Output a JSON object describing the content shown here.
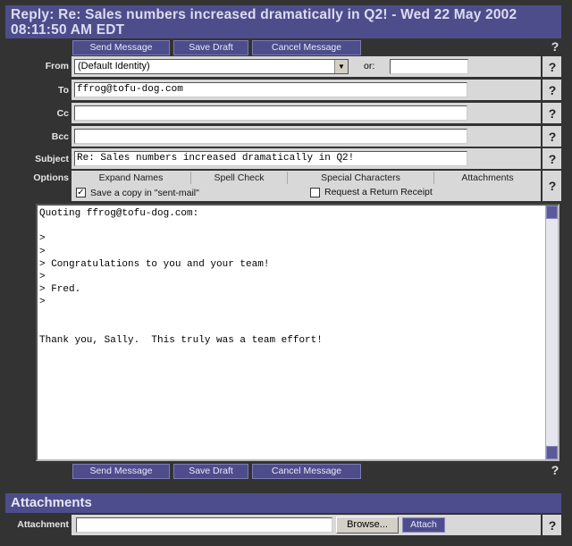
{
  "title": "Reply: Re: Sales numbers increased dramatically in Q2! - Wed 22 May 2002 08:11:50 AM EDT",
  "buttons": {
    "send": "Send Message",
    "save": "Save Draft",
    "cancel": "Cancel Message"
  },
  "help": "?",
  "labels": {
    "from": "From",
    "to": "To",
    "cc": "Cc",
    "bcc": "Bcc",
    "subject": "Subject",
    "options": "Options",
    "or": "or:"
  },
  "from_value": "(Default Identity)",
  "to_value": "ffrog@tofu-dog.com",
  "cc_value": "",
  "bcc_value": "",
  "subject_value": "Re: Sales numbers increased dramatically in Q2!",
  "options": {
    "expand": "Expand Names",
    "spell": "Spell Check",
    "special": "Special Characters",
    "attachments": "Attachments",
    "save_copy": "Save a copy in \"sent-mail\"",
    "save_copy_checked": true,
    "return_receipt": "Request a Return Receipt",
    "return_receipt_checked": false
  },
  "body": "Quoting ffrog@tofu-dog.com:\n\n>\n>\n> Congratulations to you and your team!\n>\n> Fred.\n>\n\n\nThank you, Sally.  This truly was a team effort!",
  "attachments": {
    "heading": "Attachments",
    "label": "Attachment",
    "browse": "Browse...",
    "attach": "Attach"
  },
  "check_mark": "✓",
  "arrow_down": "▼"
}
